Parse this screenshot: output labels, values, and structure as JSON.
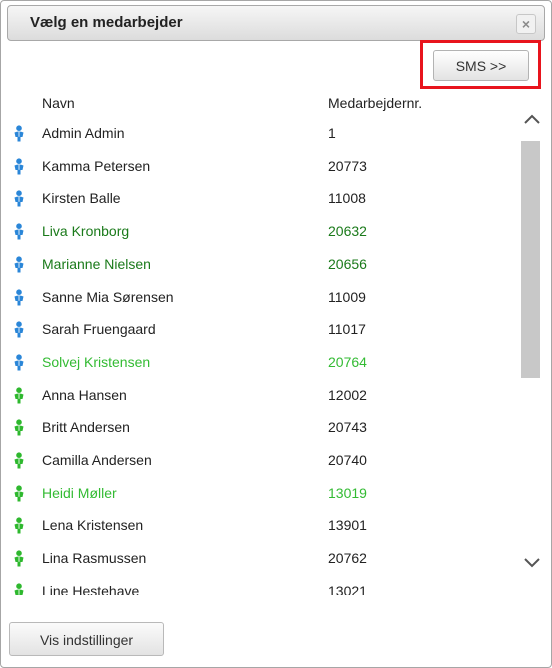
{
  "dialog": {
    "title": "Vælg en medarbejder",
    "close_symbol": "×"
  },
  "toolbar": {
    "sms_label": "SMS >>"
  },
  "columns": {
    "name": "Navn",
    "number": "Medarbejdernr."
  },
  "colors": {
    "default_text": "#222222",
    "dark_green_text": "#1a7a1a",
    "light_green_text": "#33bb33",
    "pin_blue": "#2a86d8",
    "pin_green": "#2eb82e",
    "highlight_red": "#e8141d"
  },
  "employees": [
    {
      "name": "Admin Admin",
      "number": "1",
      "status": "default",
      "pin": "blue"
    },
    {
      "name": "Kamma Petersen",
      "number": "20773",
      "status": "default",
      "pin": "blue"
    },
    {
      "name": "Kirsten Balle",
      "number": "11008",
      "status": "default",
      "pin": "blue"
    },
    {
      "name": "Liva Kronborg",
      "number": "20632",
      "status": "dark_green",
      "pin": "blue"
    },
    {
      "name": "Marianne Nielsen",
      "number": "20656",
      "status": "dark_green",
      "pin": "blue"
    },
    {
      "name": "Sanne Mia Sørensen",
      "number": "11009",
      "status": "default",
      "pin": "blue"
    },
    {
      "name": "Sarah Fruengaard",
      "number": "11017",
      "status": "default",
      "pin": "blue"
    },
    {
      "name": "Solvej Kristensen",
      "number": "20764",
      "status": "light_green",
      "pin": "blue"
    },
    {
      "name": "Anna Hansen",
      "number": "12002",
      "status": "default",
      "pin": "green"
    },
    {
      "name": "Britt Andersen",
      "number": "20743",
      "status": "default",
      "pin": "green"
    },
    {
      "name": "Camilla Andersen",
      "number": "20740",
      "status": "default",
      "pin": "green"
    },
    {
      "name": "Heidi Møller",
      "number": "13019",
      "status": "light_green",
      "pin": "green"
    },
    {
      "name": "Lena Kristensen",
      "number": "13901",
      "status": "default",
      "pin": "green"
    },
    {
      "name": "Lina Rasmussen",
      "number": "20762",
      "status": "default",
      "pin": "green"
    },
    {
      "name": "Line Hestehave",
      "number": "13021",
      "status": "default",
      "pin": "green"
    }
  ],
  "footer": {
    "settings_label": "Vis indstillinger"
  },
  "icons": {
    "person": "person-pin-icon",
    "close": "close-icon",
    "scroll_up": "chevron-up-icon",
    "scroll_down": "chevron-down-icon"
  }
}
